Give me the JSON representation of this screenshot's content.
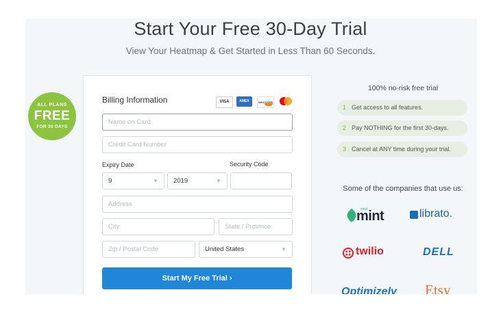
{
  "hero": {
    "title": "Start Your Free 30-Day Trial",
    "subtitle": "View Your Heatmap & Get Started in Less Than 60 Seconds."
  },
  "badge": {
    "line1": "ALL PLANS",
    "line2": "FREE",
    "line3": "FOR 30 DAYS"
  },
  "form": {
    "title": "Billing Information",
    "card_types": [
      "VISA",
      "AMEX",
      "DISCOVER",
      "MasterCard"
    ],
    "name_placeholder": "Name on Card",
    "card_number_placeholder": "Credit Card Number",
    "expiry_label": "Expiry Date",
    "security_label": "Security Code",
    "expiry_month": "9",
    "expiry_year": "2019",
    "address_placeholder": "Address",
    "city_placeholder": "City",
    "state_placeholder": "State / Province",
    "zip_placeholder": "Zip / Postal Code",
    "country": "United States",
    "submit_label": "Start My Free Trial ›"
  },
  "trial": {
    "heading": "100% no-risk free trial",
    "steps": [
      {
        "num": "1",
        "text": "Get access to all features."
      },
      {
        "num": "2",
        "text": "Pay NOTHING for the first 30-days."
      },
      {
        "num": "3",
        "text": "Cancel at ANY time during your trial."
      }
    ]
  },
  "companies": {
    "heading": "Some of the companies that use us:",
    "logos": [
      "mint",
      "librato.",
      "twilio",
      "DELL",
      "Optimizely",
      "Etsy"
    ],
    "mint_small": "intuit"
  },
  "colors": {
    "accent": "#1f86d8",
    "badge": "#8cc43f",
    "step_bg": "#e6efe2",
    "panel_bg": "#f3f7fa"
  }
}
